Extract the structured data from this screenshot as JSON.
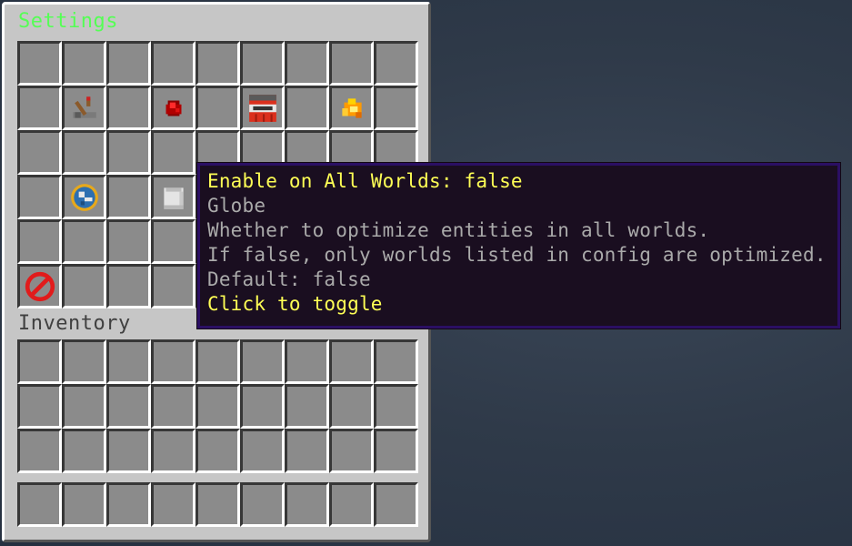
{
  "settings_title": "Settings",
  "inventory_title": "Inventory",
  "colors": {
    "settings_title": "#55ff55",
    "inventory_title": "#404040",
    "tooltip_title": "#ffff55",
    "tooltip_text": "#aaaaaa",
    "tooltip_action": "#ffff55"
  },
  "settings_items": [
    {
      "row": 1,
      "col": 1,
      "icon": "lever-icon"
    },
    {
      "row": 1,
      "col": 3,
      "icon": "redstone-dust-icon"
    },
    {
      "row": 1,
      "col": 5,
      "icon": "tnt-icon"
    },
    {
      "row": 1,
      "col": 7,
      "icon": "blaze-powder-icon"
    },
    {
      "row": 3,
      "col": 1,
      "icon": "globe-banner-pattern-icon"
    },
    {
      "row": 3,
      "col": 3,
      "icon": "bucket-icon"
    },
    {
      "row": 5,
      "col": 0,
      "icon": "barrier-icon"
    }
  ],
  "tooltip": {
    "title": "Enable on All Worlds: false",
    "lines": [
      "Globe",
      "Whether to optimize entities in all worlds.",
      "If false, only worlds listed in config are optimized.",
      "Default: false"
    ],
    "action": "Click to toggle"
  }
}
